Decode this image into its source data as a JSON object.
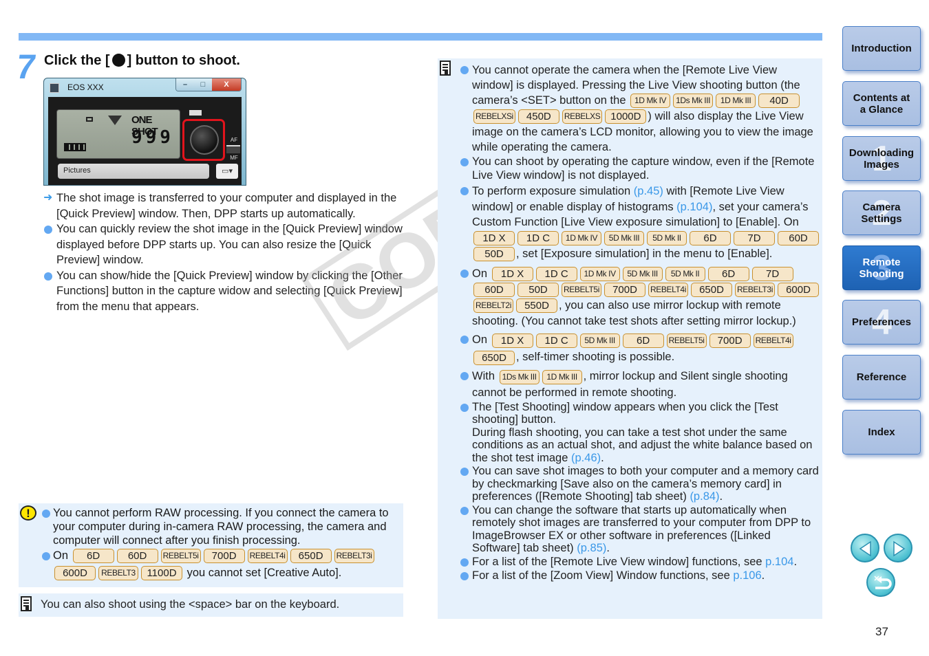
{
  "step": {
    "number": "7",
    "title_before": "Click the [",
    "title_after": "] button to shoot."
  },
  "capture_window": {
    "title": "EOS XXX",
    "window_buttons": [
      "–",
      "□",
      "X"
    ],
    "lcd_mode": "ONE SHOT",
    "lcd_count": "999",
    "af_label": "AF",
    "mf_label": "MF",
    "folder_path": "Pictures",
    "folder_button": "▾"
  },
  "body": {
    "result": "The shot image is transferred to your computer and displayed in the [Quick Preview] window. Then, DPP starts up automatically.",
    "bullets": [
      "You can quickly review the shot image in the [Quick Preview] window displayed before DPP starts up. You can also resize the [Quick Preview] window.",
      "You can show/hide the [Quick Preview] window by clicking the [Other Functions] button in the capture widow and selecting [Quick Preview] from the menu that appears."
    ]
  },
  "caution": {
    "icon": "!",
    "item1": "You cannot perform RAW processing. If you connect the camera to your computer during in-camera RAW processing, the camera and computer will connect after you finish processing.",
    "item2_prefix": "On",
    "item2_badges": [
      "6D",
      "60D",
      "REBELT5i",
      "700D",
      "REBELT4i",
      "650D",
      "REBELT3i",
      "600D",
      "REBELT3",
      "1100D"
    ],
    "item2_suffix": "you cannot set [Creative Auto]."
  },
  "note_left": {
    "text": "You can also shoot using the <space> bar on the keyboard."
  },
  "note_right": {
    "n1_a": "You cannot operate the camera when the [Remote Live View window] is displayed. Pressing the Live View shooting button (the camera’s <SET> button on the",
    "n1_badges": [
      "1D Mk IV",
      "1Ds Mk III",
      "1D Mk III",
      "40D",
      "REBELXSi",
      "450D",
      "REBELXS",
      "1000D"
    ],
    "n1_b": ") will also display the Live View image on the camera’s LCD monitor, allowing you to view the image while operating the camera.",
    "n2": "You can shoot by operating the capture window, even if the [Remote Live View window] is not displayed.",
    "n3_a": "To perform exposure simulation",
    "n3_link1": "(p.45)",
    "n3_b": "with [Remote Live View window] or enable display of histograms",
    "n3_link2": "(p.104)",
    "n3_c": ", set your camera’s Custom Function [Live View exposure simulation] to [Enable]. On",
    "n3_badges": [
      "1D X",
      "1D C",
      "1D Mk IV",
      "5D Mk III",
      "5D Mk II",
      "6D",
      "7D",
      "60D",
      "50D"
    ],
    "n3_d": ", set [Exposure simulation] in the menu to [Enable].",
    "n4_prefix": "On",
    "n4_badges": [
      "1D X",
      "1D C",
      "1D Mk IV",
      "5D Mk III",
      "5D Mk II",
      "6D",
      "7D",
      "60D",
      "50D",
      "REBELT5i",
      "700D",
      "REBELT4i",
      "650D",
      "REBELT3i",
      "600D",
      "REBELT2i",
      "550D"
    ],
    "n4_suffix": ", you can also use mirror lockup with remote shooting. (You cannot take test shots after setting mirror lockup.)",
    "n5_prefix": "On",
    "n5_badges": [
      "1D X",
      "1D C",
      "5D Mk III",
      "6D",
      "REBELT5i",
      "700D",
      "REBELT4i",
      "650D"
    ],
    "n5_suffix": ", self-timer shooting is possible.",
    "n6_prefix": "With",
    "n6_badges": [
      "1Ds Mk III",
      "1D Mk III"
    ],
    "n6_suffix": ", mirror lockup and Silent single shooting cannot be performed in remote shooting.",
    "n7_a": "The [Test Shooting] window appears when you click the [Test shooting] button.",
    "n7_b": "During flash shooting, you can take a test shot under the same conditions as an actual shot, and adjust the white balance based on the shot test image",
    "n7_link": "(p.46)",
    "n8_a": "You can save shot images to both your computer and a memory card by checkmarking [Save also on the camera’s memory card] in preferences ([Remote Shooting] tab sheet)",
    "n8_link": "(p.84)",
    "n9_a": "You can change the software that starts up automatically when remotely shot images are transferred to your computer from DPP to ImageBrowser EX or other software in preferences ([Linked Software] tab sheet)",
    "n9_link": "(p.85)",
    "n10_a": "For a list of the [Remote Live View window] functions, see",
    "n10_link": "p.104",
    "n11_a": "For a list of the [Zoom View] Window functions, see",
    "n11_link": "p.106"
  },
  "watermark": "COPY",
  "nav": {
    "items": [
      {
        "label": "Introduction",
        "num": ""
      },
      {
        "label": "Contents at a Glance",
        "num": ""
      },
      {
        "label": "Downloading Images",
        "num": "1"
      },
      {
        "label": "Camera Settings",
        "num": "2"
      },
      {
        "label": "Remote Shooting",
        "num": "3",
        "active": true
      },
      {
        "label": "Preferences",
        "num": "4"
      },
      {
        "label": "Reference",
        "num": ""
      },
      {
        "label": "Index",
        "num": ""
      }
    ],
    "prev_icon": "prev-page",
    "next_icon": "next-page",
    "return_icon": "return"
  },
  "page_number": "37",
  "colors": {
    "accent_blue": "#82b8f5",
    "note_bg": "#e6f1fc",
    "badge_bg": "#f6e6c9",
    "badge_border": "#c8902e",
    "link": "#3a98e8",
    "nav_active": "#1e62b3"
  }
}
